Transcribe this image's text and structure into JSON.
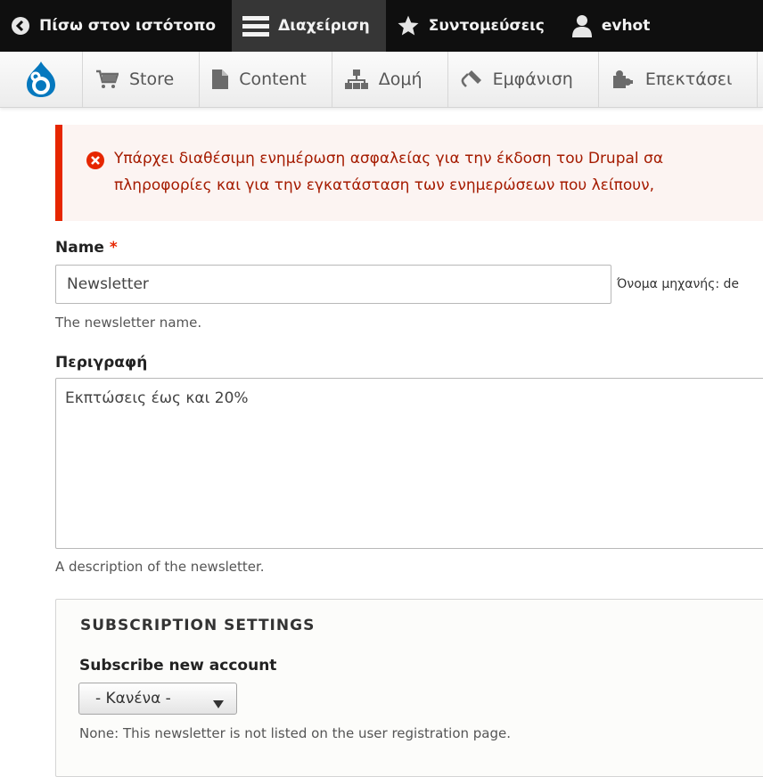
{
  "toolbar": {
    "back_label": "Πίσω στον ιστότοπο",
    "manage_label": "Διαχείριση",
    "shortcuts_label": "Συντομεύσεις",
    "user_label": "evhot"
  },
  "tray": {
    "items": [
      {
        "label": "Store",
        "icon": "cart-icon"
      },
      {
        "label": "Content",
        "icon": "page-icon"
      },
      {
        "label": "Δομή",
        "icon": "sitemap-icon"
      },
      {
        "label": "Εμφάνιση",
        "icon": "paintbrush-icon"
      },
      {
        "label": "Επεκτάσει",
        "icon": "puzzle-icon"
      }
    ]
  },
  "error": {
    "line1": "Υπάρχει διαθέσιμη ενημέρωση ασφαλείας για την έκδοση του Drupal σα",
    "line2": "πληροφορίες και για την εγκατάσταση των ενημερώσεων που λείπουν,"
  },
  "form": {
    "name_label": "Name",
    "name_required": "*",
    "name_value": "Newsletter",
    "machine_name": "Όνομα μηχανής: de",
    "name_help": "The newsletter name.",
    "description_label": "Περιγραφή",
    "description_value": "Εκπτώσεις έως και 20%",
    "description_help": "A description of the newsletter."
  },
  "subscription": {
    "legend": "SUBSCRIPTION SETTINGS",
    "subscribe_label": "Subscribe new account",
    "select_value": "- Κανένα -",
    "help": "None: This newsletter is not listed on the user registration page."
  },
  "colors": {
    "error_accent": "#e62600",
    "toolbar_bg": "#0f0f0f",
    "drupal_blue": "#0678be"
  }
}
